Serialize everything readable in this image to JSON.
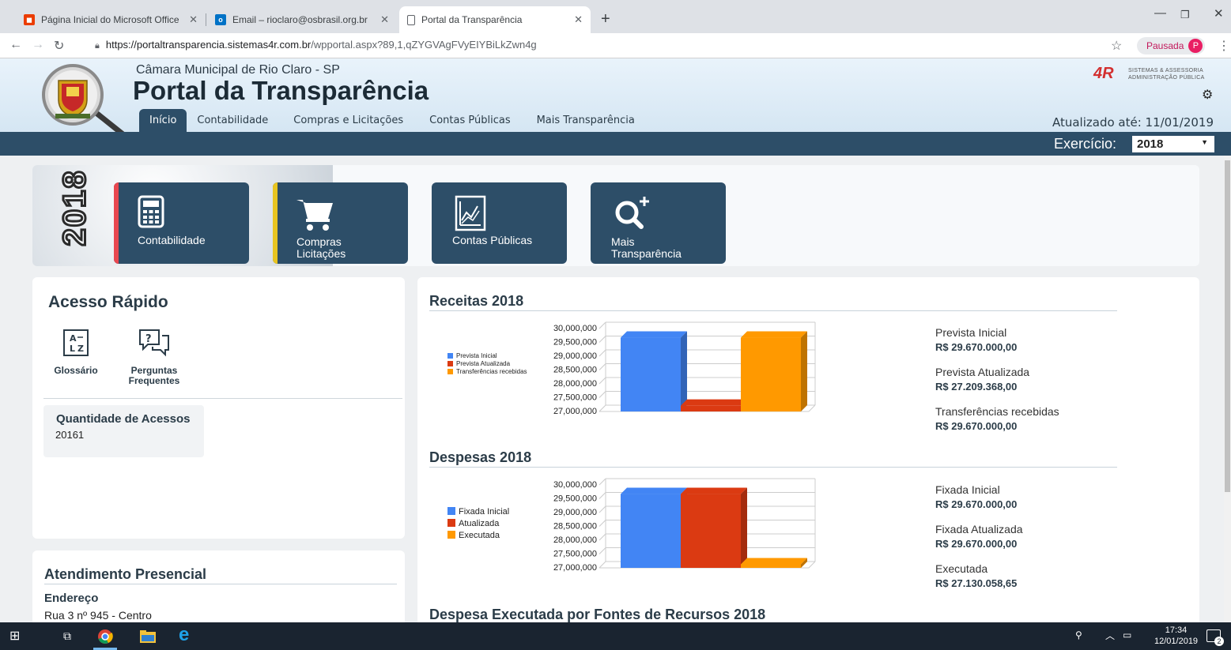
{
  "browser": {
    "tabs": [
      {
        "title": "Página Inicial do Microsoft Office",
        "icon": "office-icon"
      },
      {
        "title": "Email – rioclaro@osbrasil.org.br",
        "icon": "outlook-icon"
      },
      {
        "title": "Portal da Transparência",
        "icon": "page-icon"
      }
    ],
    "url_host": "https://portaltransparencia.sistemas4r.com.br",
    "url_path": "/wpportal.aspx?89,1,qZYGVAgFVyEIYBiLkZwn4g",
    "profile_label": "Pausada",
    "profile_initial": "P"
  },
  "header": {
    "camara": "Câmara Municipal de Rio Claro - SP",
    "title": "Portal da Transparência",
    "nav": [
      "Início",
      "Contabilidade",
      "Compras e Licitações",
      "Contas Públicas",
      "Mais Transparência"
    ],
    "active_nav": "Início",
    "updated": "Atualizado até: 11/01/2019",
    "logo_mark": "4R",
    "logo_text_1": "SISTEMAS & ASSESSORIA",
    "logo_text_2": "ADMINISTRAÇÃO PÚBLICA",
    "exercicio_label": "Exercício:",
    "exercicio_value": "2018"
  },
  "banner": {
    "year": "2018",
    "tiles": [
      {
        "label": "Contabilidade",
        "icon": "calculator-icon",
        "stripe": "#e8474f"
      },
      {
        "label_1": "Compras",
        "label_2": "Licitações",
        "icon": "cart-icon",
        "stripe": "#e8c420"
      },
      {
        "label": "Contas Públicas",
        "icon": "chart-document-icon"
      },
      {
        "label_1": "Mais",
        "label_2": "Transparência",
        "icon": "search-plus-icon"
      }
    ]
  },
  "quick_access": {
    "title": "Acesso Rápido",
    "items": [
      {
        "label": "Glossário",
        "icon": "glossary-az-icon"
      },
      {
        "label_1": "Perguntas",
        "label_2": "Frequentes",
        "icon": "faq-icon"
      }
    ],
    "access_title": "Quantidade de Acessos",
    "access_count": "20161"
  },
  "atendimento": {
    "title": "Atendimento Presencial",
    "endereco_label": "Endereço",
    "endereco": "Rua 3 nº 945 - Centro"
  },
  "chart_data": [
    {
      "type": "bar",
      "title": "Receitas 2018",
      "categories": [
        "Prevista Inicial",
        "Prevista Atualizada",
        "Transferências recebidas"
      ],
      "values": [
        29670000,
        27209368,
        29670000
      ],
      "colors": [
        "#4285f4",
        "#db3a12",
        "#ff9900"
      ],
      "ylim": [
        27000000,
        30000000
      ],
      "yticks": [
        "30,000,000",
        "29,500,000",
        "29,000,000",
        "28,500,000",
        "28,000,000",
        "27,500,000",
        "27,000,000"
      ],
      "legend": "left",
      "summary": [
        {
          "label": "Prevista Inicial",
          "value": "R$ 29.670.000,00"
        },
        {
          "label": "Prevista Atualizada",
          "value": "R$ 27.209.368,00"
        },
        {
          "label": "Transferências recebidas",
          "value": "R$ 29.670.000,00"
        }
      ]
    },
    {
      "type": "bar",
      "title": "Despesas 2018",
      "categories": [
        "Fixada Inicial",
        "Atualizada",
        "Executada"
      ],
      "values": [
        29670000,
        29670000,
        27130058.65
      ],
      "colors": [
        "#4285f4",
        "#db3a12",
        "#ff9900"
      ],
      "ylim": [
        27000000,
        30000000
      ],
      "yticks": [
        "30,000,000",
        "29,500,000",
        "29,000,000",
        "28,500,000",
        "28,000,000",
        "27,500,000",
        "27,000,000"
      ],
      "legend": "left",
      "summary": [
        {
          "label": "Fixada Inicial",
          "value": "R$ 29.670.000,00"
        },
        {
          "label": "Fixada Atualizada",
          "value": "R$ 29.670.000,00"
        },
        {
          "label": "Executada",
          "value": "R$ 27.130.058,65"
        }
      ]
    }
  ],
  "section3_title": "Despesa Executada por Fontes de Recursos 2018",
  "taskbar": {
    "time": "17:34",
    "date": "12/01/2019",
    "notifications": "2"
  }
}
